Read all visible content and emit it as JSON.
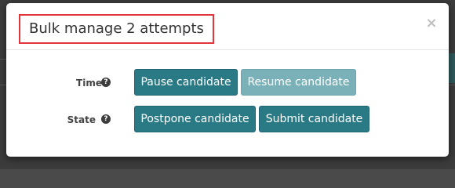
{
  "dialog": {
    "title": "Bulk manage 2 attempts",
    "close_label": "×"
  },
  "rows": {
    "time": {
      "label": "Time",
      "help_glyph": "?",
      "help_icon": "question-circle-icon",
      "pause_label": "Pause candidate",
      "resume_label": "Resume candidate",
      "resume_enabled": false
    },
    "state": {
      "label": "State",
      "help_glyph": "?",
      "help_icon": "question-circle-icon",
      "postpone_label": "Postpone candidate",
      "submit_label": "Submit candidate"
    }
  },
  "colors": {
    "primary_button": "#2a7a86",
    "disabled_button": "#7ab1b9",
    "title_highlight_border": "#e3343c"
  }
}
